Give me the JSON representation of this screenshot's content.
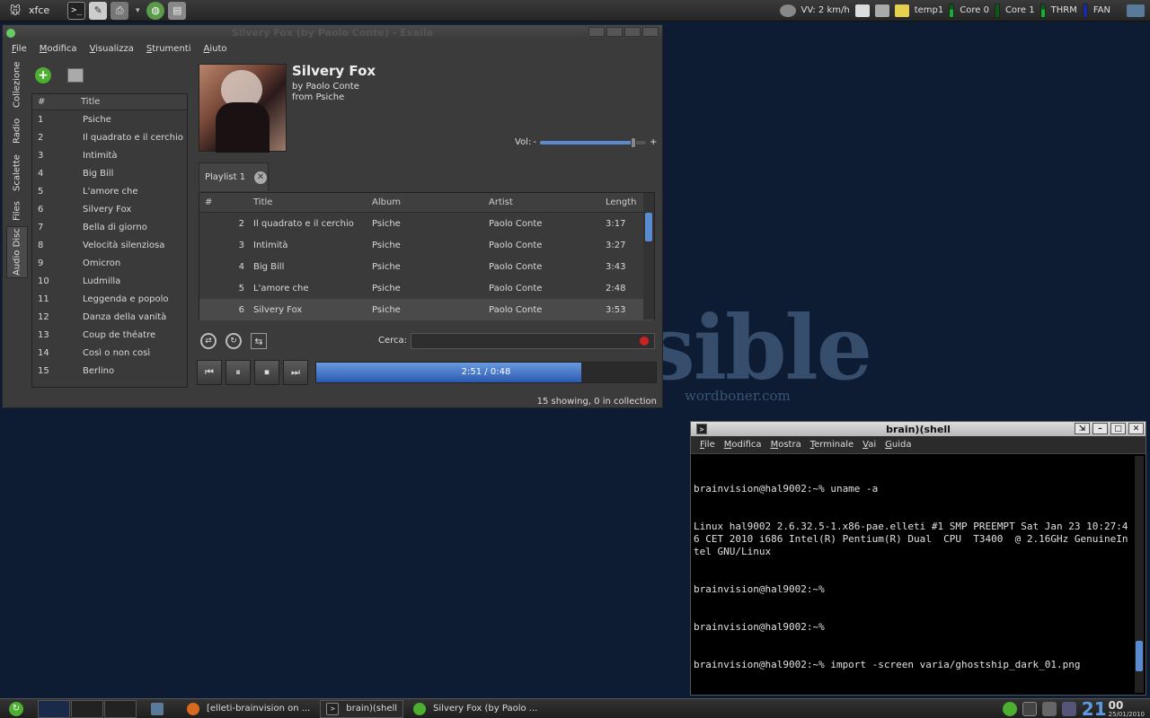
{
  "wallpaper": {
    "title": "Impossible",
    "subtitle": "wordboner.com"
  },
  "top_panel": {
    "menu_label": "xfce",
    "launchers": [
      "terminal-icon",
      "text-editor-icon",
      "printer-icon",
      "chevron-down-icon",
      "globe-icon",
      "book-icon"
    ],
    "tray": {
      "speed": "VV: 2 km/h",
      "temp": "temp1",
      "core0": "Core 0",
      "core1": "Core 1",
      "thrm": "THRM",
      "fan": "FAN"
    }
  },
  "exaile": {
    "window_title": "Silvery Fox (by Paolo Conte) - Exaile",
    "menu": [
      "File",
      "Modifica",
      "Visualizza",
      "Strumenti",
      "Aiuto"
    ],
    "side_tabs": [
      "Collezione",
      "Radio",
      "Scalette",
      "Files",
      "Audio Disc"
    ],
    "track_list": {
      "headers": {
        "num": "#",
        "title": "Title"
      },
      "rows": [
        {
          "num": "1",
          "title": "Psiche"
        },
        {
          "num": "2",
          "title": "Il quadrato e il cerchio"
        },
        {
          "num": "3",
          "title": "Intimità"
        },
        {
          "num": "4",
          "title": "Big Bill"
        },
        {
          "num": "5",
          "title": "L'amore che"
        },
        {
          "num": "6",
          "title": "Silvery Fox"
        },
        {
          "num": "7",
          "title": "Bella di giorno"
        },
        {
          "num": "8",
          "title": "Velocità silenziosa"
        },
        {
          "num": "9",
          "title": "Omicron"
        },
        {
          "num": "10",
          "title": "Ludmilla"
        },
        {
          "num": "11",
          "title": "Leggenda e popolo"
        },
        {
          "num": "12",
          "title": "Danza della vanità"
        },
        {
          "num": "13",
          "title": "Coup de théatre"
        },
        {
          "num": "14",
          "title": "Così o non così"
        },
        {
          "num": "15",
          "title": "Berlino"
        }
      ]
    },
    "now_playing": {
      "title": "Silvery Fox",
      "by": "by Paolo Conte",
      "from": "from Psiche"
    },
    "volume": {
      "label": "Vol:",
      "minus": "-",
      "plus": "+",
      "level": 0.88
    },
    "playlist_tab": {
      "label": "Playlist 1"
    },
    "playlist": {
      "headers": {
        "num": "#",
        "title": "Title",
        "album": "Album",
        "artist": "Artist",
        "length": "Length"
      },
      "rows": [
        {
          "num": "2",
          "title": "Il quadrato e il cerchio",
          "album": "Psiche",
          "artist": "Paolo Conte",
          "length": "3:17"
        },
        {
          "num": "3",
          "title": "Intimità",
          "album": "Psiche",
          "artist": "Paolo Conte",
          "length": "3:27"
        },
        {
          "num": "4",
          "title": "Big Bill",
          "album": "Psiche",
          "artist": "Paolo Conte",
          "length": "3:43"
        },
        {
          "num": "5",
          "title": "L'amore che",
          "album": "Psiche",
          "artist": "Paolo Conte",
          "length": "2:48"
        },
        {
          "num": "6",
          "title": "Silvery Fox",
          "album": "Psiche",
          "artist": "Paolo Conte",
          "length": "3:53"
        }
      ]
    },
    "search": {
      "label": "Cerca:",
      "value": ""
    },
    "progress": {
      "text": "2:51 / 0:48",
      "fraction": 0.78
    },
    "status": "15 showing, 0 in collection"
  },
  "terminal": {
    "title": "brain)(shell",
    "menu": [
      "File",
      "Modifica",
      "Mostra",
      "Terminale",
      "Vai",
      "Guida"
    ],
    "lines": [
      "brainvision@hal9002:~% uname -a",
      "Linux hal9002 2.6.32.5-1.x86-pae.elleti #1 SMP PREEMPT Sat Jan 23 10:27:46 CET 2010 i686 Intel(R) Pentium(R) Dual  CPU  T3400  @ 2.16GHz GenuineIntel GNU/Linux",
      "brainvision@hal9002:~%",
      "brainvision@hal9002:~%",
      "brainvision@hal9002:~% import -screen varia/ghostship_dark_01.png"
    ]
  },
  "taskbar": {
    "tasks": [
      {
        "label": "[elleti-brainvision on ..."
      },
      {
        "label": "brain)(shell"
      },
      {
        "label": "Silvery Fox (by Paolo ..."
      }
    ],
    "clock": {
      "hour": "21",
      "minute": "00",
      "date": "25/01/2010"
    }
  }
}
